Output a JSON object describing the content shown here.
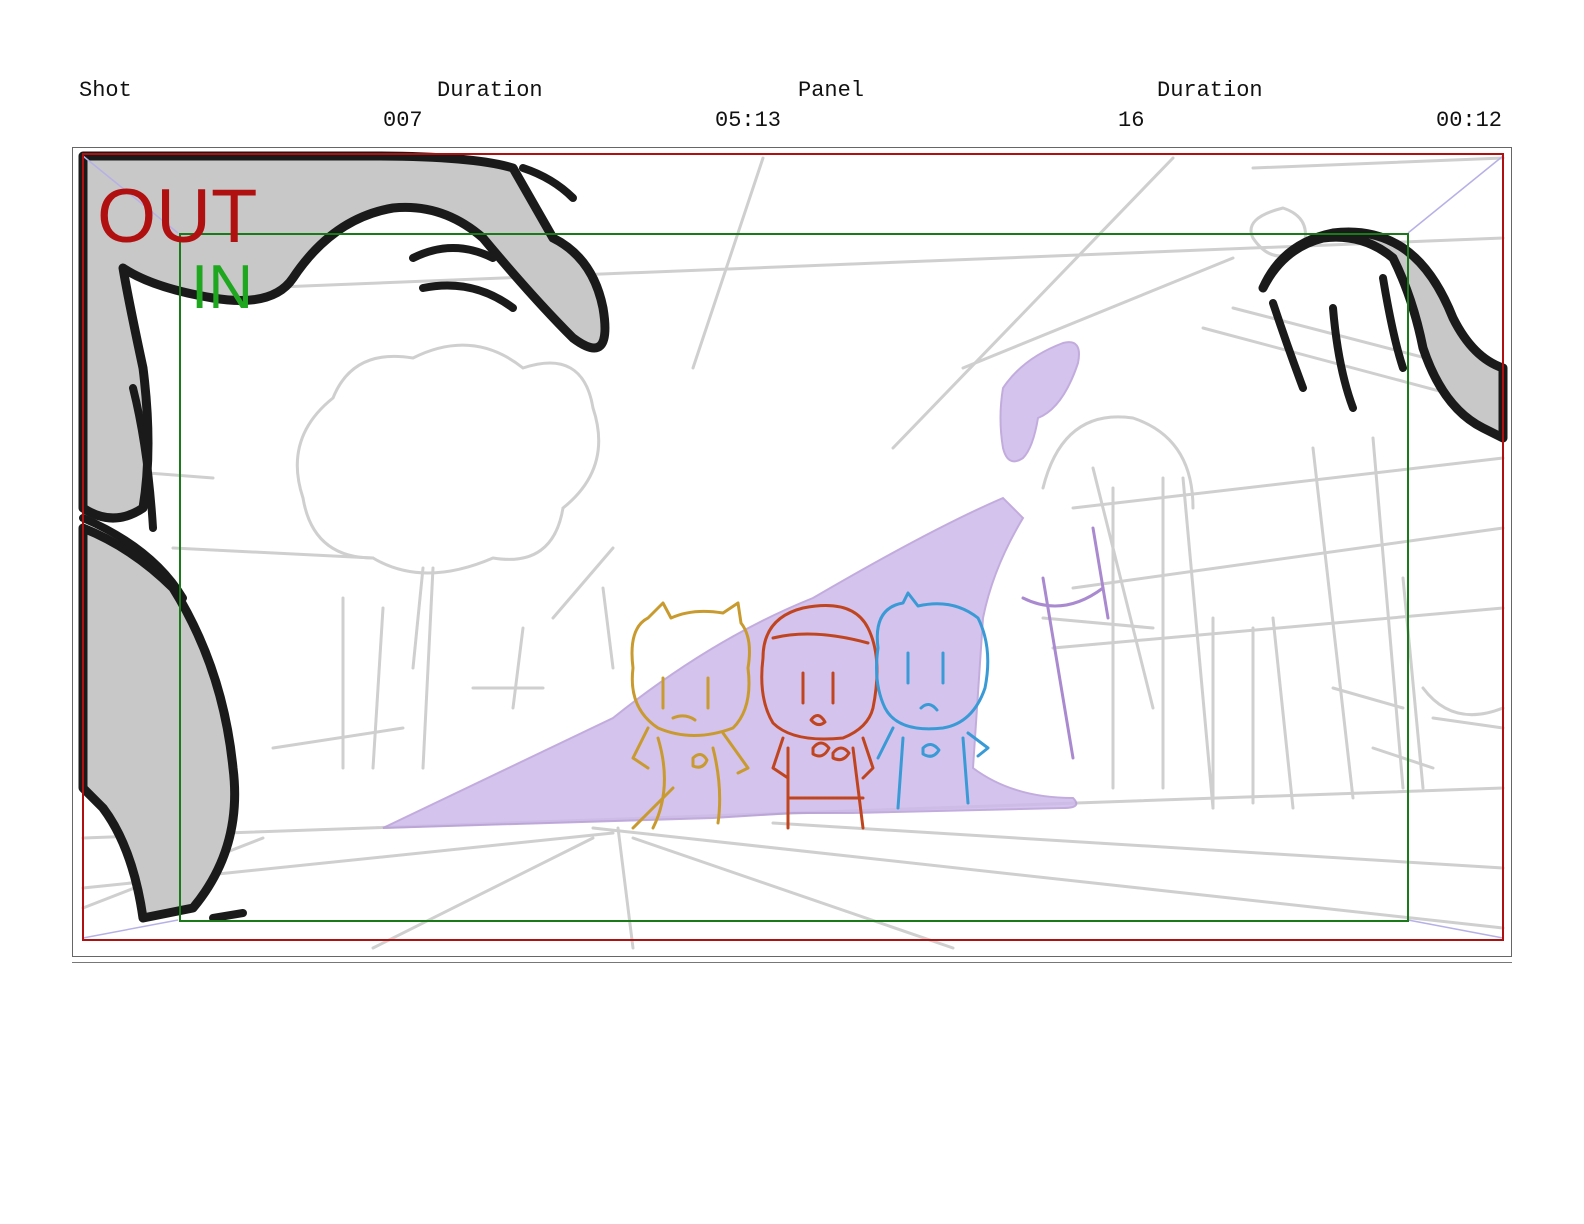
{
  "header": {
    "labels": {
      "shot": "Shot",
      "shot_duration": "Duration",
      "panel": "Panel",
      "panel_duration": "Duration"
    },
    "values": {
      "shot": "007",
      "shot_duration": "05:13",
      "panel": "16",
      "panel_duration": "00:12"
    }
  },
  "frame": {
    "out_label": "OUT",
    "in_label": "IN",
    "colors": {
      "out_frame": "#b01010",
      "in_frame": "#1a7a1a",
      "sketch_gray": "#c8c8c8",
      "shadow_purple": "#c9b6e6",
      "character_yellow": "#c99a2e",
      "character_red": "#c0451f",
      "character_blue": "#3a9ad6"
    }
  }
}
